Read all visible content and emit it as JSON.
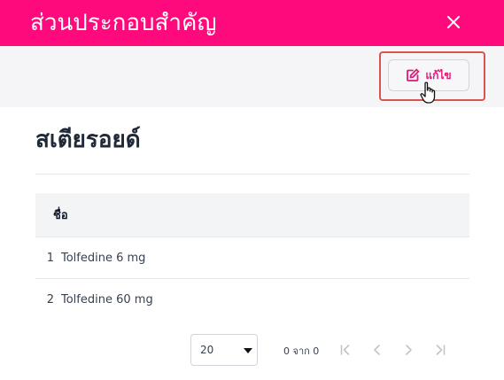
{
  "colors": {
    "header_bg": "#ff0a7d",
    "accent": "#e5157a",
    "toolbar_bg": "#f5f5f7",
    "highlight_border": "#d9534f"
  },
  "dialog": {
    "title": "ส่วนประกอบสำคัญ",
    "close_icon": "close-icon"
  },
  "toolbar": {
    "edit_label": "แก้ไข",
    "edit_icon": "edit-icon"
  },
  "section": {
    "heading": "สเตียรอยด์"
  },
  "table": {
    "columns": [
      "ชื่อ"
    ],
    "rows": [
      {
        "index": "1",
        "name": "Tolfedine 6 mg"
      },
      {
        "index": "2",
        "name": "Tolfedine 60 mg"
      }
    ]
  },
  "pagination": {
    "page_size": "20",
    "range_text": "0 จาก 0",
    "icons": [
      "first-page-icon",
      "prev-page-icon",
      "next-page-icon",
      "last-page-icon"
    ]
  }
}
